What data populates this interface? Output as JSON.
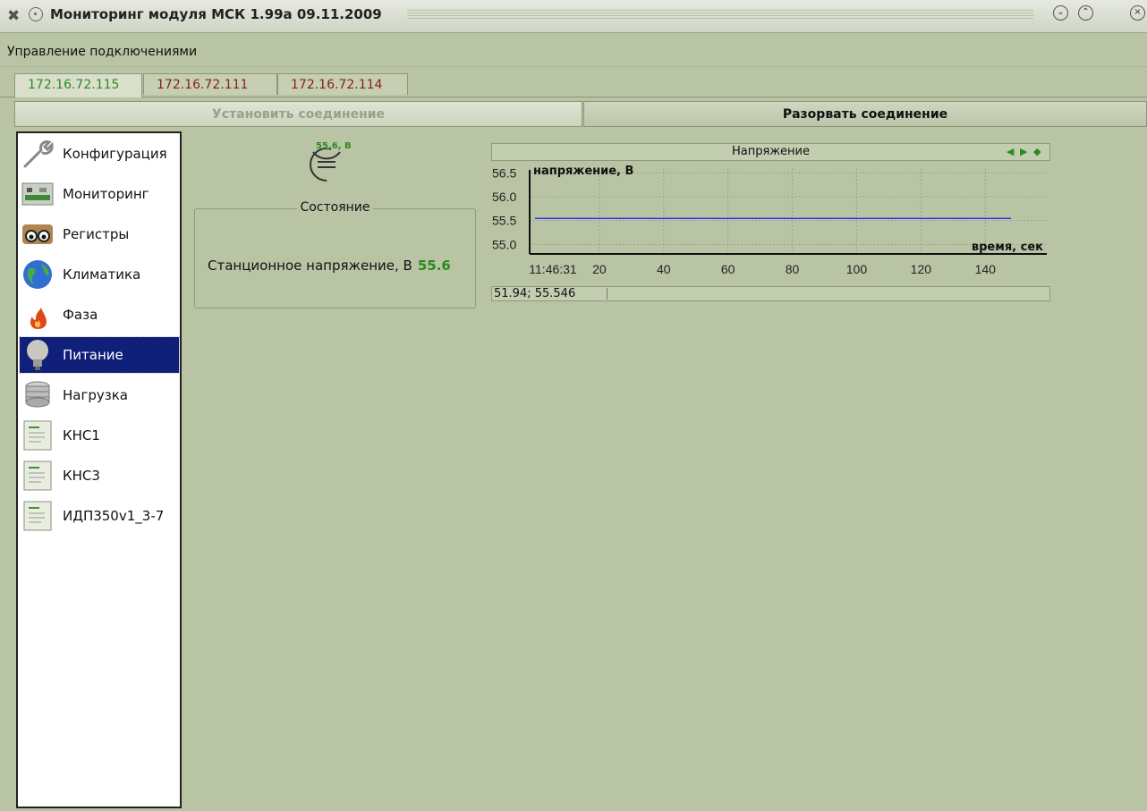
{
  "window": {
    "title": "Мониторинг модуля МСК 1.99а 09.11.2009",
    "wm_icon": "tools-icon",
    "buttons": [
      "minimize-icon",
      "maximize-icon",
      "close-icon"
    ]
  },
  "menu": {
    "connections": "Управление подключениями"
  },
  "tabs": [
    {
      "label": "172.16.72.115",
      "active": true
    },
    {
      "label": "172.16.72.111",
      "active": false
    },
    {
      "label": "172.16.72.114",
      "active": false
    }
  ],
  "connection": {
    "connect_label": "Установить соединение",
    "disconnect_label": "Разорвать соединение",
    "connect_enabled": false
  },
  "sidebar": {
    "selected": "Питание",
    "items": [
      {
        "label": "Конфигурация",
        "icon": "wrench-icon"
      },
      {
        "label": "Мониторинг",
        "icon": "circuit-board-icon"
      },
      {
        "label": "Регистры",
        "icon": "eyes-icon"
      },
      {
        "label": "Климатика",
        "icon": "globe-icon"
      },
      {
        "label": "Фаза",
        "icon": "fire-icon"
      },
      {
        "label": "Питание",
        "icon": "lightbulb-icon"
      },
      {
        "label": "Нагрузка",
        "icon": "server-icon"
      },
      {
        "label": "КНС1",
        "icon": "document-icon"
      },
      {
        "label": "КНС3",
        "icon": "document-icon"
      },
      {
        "label": "ИДП350v1_3-7",
        "icon": "document-icon"
      }
    ]
  },
  "indicator": {
    "label": "55.6, В",
    "icon": "gauge-icon"
  },
  "state": {
    "title": "Состояние",
    "row_label": "Станционное напряжение, В",
    "row_value": "55.6",
    "value_color": "#2a8c1c"
  },
  "chart_panel": {
    "nav_icons": [
      "arrow-left-icon",
      "arrow-right-icon",
      "diamond-icon"
    ],
    "status": "51.94; 55.546"
  },
  "chart_data": {
    "type": "line",
    "title": "Напряжение",
    "ylabel": "напряжение, В",
    "xlabel": "время, сек",
    "first_tick_label": "11:46:31",
    "xticks": [
      20,
      40,
      60,
      80,
      100,
      120,
      140
    ],
    "yticks": [
      "56.5",
      "56.0",
      "55.5",
      "55.0"
    ],
    "xlim": [
      0,
      150
    ],
    "ylim": [
      54.8,
      56.6
    ],
    "grid": true,
    "series": [
      {
        "color": "#1a1aff",
        "x": [
          0,
          148
        ],
        "y": [
          55.546,
          55.546
        ]
      }
    ]
  }
}
